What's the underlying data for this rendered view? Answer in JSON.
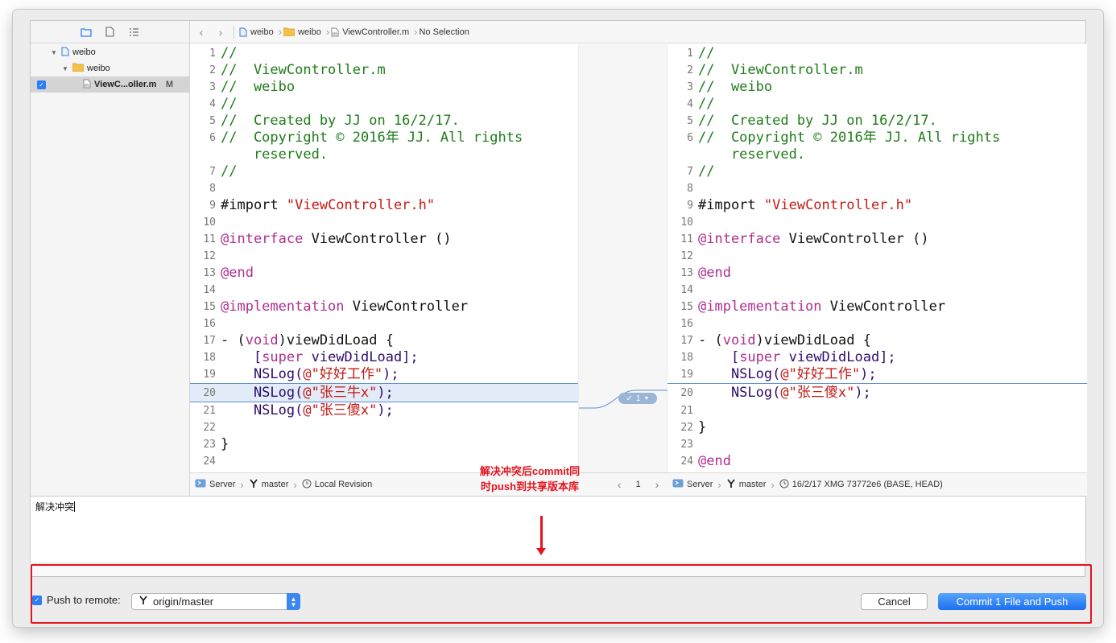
{
  "navigator": {
    "items": [
      {
        "label": "weibo",
        "kind": "project"
      },
      {
        "label": "weibo",
        "kind": "folder"
      },
      {
        "label": "ViewC...oller.m",
        "kind": "file",
        "badge": "M",
        "checked": true
      }
    ]
  },
  "jumpbar": {
    "crumbs": [
      "weibo",
      "weibo",
      "ViewController.m",
      "No Selection"
    ]
  },
  "left_pane": {
    "lines": [
      {
        "n": "1",
        "t": "//"
      },
      {
        "n": "2",
        "t": "//  ViewController.m"
      },
      {
        "n": "3",
        "t": "//  weibo"
      },
      {
        "n": "4",
        "t": "//"
      },
      {
        "n": "5",
        "t": "//  Created by JJ on 16/2/17."
      },
      {
        "n": "6",
        "t": "//  Copyright © 2016年 JJ. All rights"
      },
      {
        "n": "",
        "t": "    reserved."
      },
      {
        "n": "7",
        "t": "//"
      },
      {
        "n": "8",
        "t": ""
      },
      {
        "n": "9",
        "t": "#import \"ViewController.h\""
      },
      {
        "n": "10",
        "t": ""
      },
      {
        "n": "11",
        "t": "@interface ViewController ()"
      },
      {
        "n": "12",
        "t": ""
      },
      {
        "n": "13",
        "t": "@end"
      },
      {
        "n": "14",
        "t": ""
      },
      {
        "n": "15",
        "t": "@implementation ViewController"
      },
      {
        "n": "16",
        "t": ""
      },
      {
        "n": "17",
        "t": "- (void)viewDidLoad {"
      },
      {
        "n": "18",
        "t": "    [super viewDidLoad];"
      },
      {
        "n": "19",
        "t": "    NSLog(@\"好好工作\");"
      },
      {
        "n": "20",
        "t": "    NSLog(@\"张三牛x\");"
      },
      {
        "n": "21",
        "t": "    NSLog(@\"张三傻x\");"
      },
      {
        "n": "22",
        "t": ""
      },
      {
        "n": "23",
        "t": "}"
      },
      {
        "n": "24",
        "t": ""
      }
    ]
  },
  "right_pane": {
    "lines": [
      {
        "n": "1",
        "t": "//"
      },
      {
        "n": "2",
        "t": "//  ViewController.m"
      },
      {
        "n": "3",
        "t": "//  weibo"
      },
      {
        "n": "4",
        "t": "//"
      },
      {
        "n": "5",
        "t": "//  Created by JJ on 16/2/17."
      },
      {
        "n": "6",
        "t": "//  Copyright © 2016年 JJ. All rights"
      },
      {
        "n": "",
        "t": "    reserved."
      },
      {
        "n": "7",
        "t": "//"
      },
      {
        "n": "8",
        "t": ""
      },
      {
        "n": "9",
        "t": "#import \"ViewController.h\""
      },
      {
        "n": "10",
        "t": ""
      },
      {
        "n": "11",
        "t": "@interface ViewController ()"
      },
      {
        "n": "12",
        "t": ""
      },
      {
        "n": "13",
        "t": "@end"
      },
      {
        "n": "14",
        "t": ""
      },
      {
        "n": "15",
        "t": "@implementation ViewController"
      },
      {
        "n": "16",
        "t": ""
      },
      {
        "n": "17",
        "t": "- (void)viewDidLoad {"
      },
      {
        "n": "18",
        "t": "    [super viewDidLoad];"
      },
      {
        "n": "19",
        "t": "    NSLog(@\"好好工作\");"
      },
      {
        "n": "20",
        "t": "    NSLog(@\"张三傻x\");"
      },
      {
        "n": "21",
        "t": ""
      },
      {
        "n": "22",
        "t": "}"
      },
      {
        "n": "23",
        "t": ""
      },
      {
        "n": "24",
        "t": "@end"
      }
    ]
  },
  "conflict_badge": {
    "count": "1"
  },
  "status_left": {
    "server": "Server",
    "branch": "master",
    "revision": "Local Revision"
  },
  "status_mid": {
    "page": "1"
  },
  "status_right": {
    "server": "Server",
    "branch": "master",
    "revision": "16/2/17  XMG  73772e6 (BASE, HEAD)"
  },
  "commit_message": "解决冲突",
  "push": {
    "label": "Push to remote:",
    "checked": true,
    "remote": "origin/master"
  },
  "buttons": {
    "cancel": "Cancel",
    "commit": "Commit 1 File and Push"
  },
  "annotation": {
    "line1": "解决冲突后commit同",
    "line2": "时push到共享版本库"
  },
  "colors": {
    "accent": "#2a7ef7",
    "annotation": "#e4141f",
    "comment": "#1f7c1a",
    "keyword": "#ad2e91",
    "string": "#c41a16"
  }
}
